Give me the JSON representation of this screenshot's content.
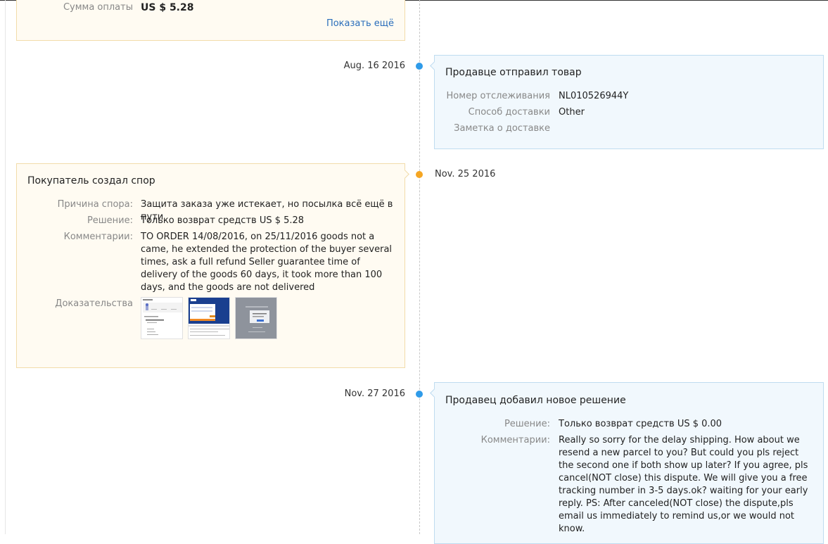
{
  "order_card": {
    "amount_label": "Сумма оплаты",
    "amount_value": "US $ 5.28",
    "show_more": "Показать ещё"
  },
  "events": [
    {
      "date": "Aug. 16 2016",
      "title": "Продавце отправил товар",
      "tracking_label": "Номер отслеживания",
      "tracking_value": "NL010526944Y",
      "method_label": "Способ доставки",
      "method_value": "Other",
      "note_label": "Заметка о доставке"
    },
    {
      "date": "Nov. 25 2016",
      "title": "Покупатель создал спор",
      "reason_label": "Причина спора:",
      "reason_value": "Защита заказа уже истекает, но посылка всё ещё в пути",
      "solution_label": "Решение:",
      "solution_value": "Только возврат средств US $ 5.28",
      "comment_label": "Комментарии:",
      "comment_value": "TO ORDER 14/08/2016, on 25/11/2016 goods not a came, he extended the protection of the buyer several times, ask a full refund Seller guarantee time of delivery of the goods 60 days, it took more than 100 days, and the goods are not delivered",
      "evidence_label": "Доказательства"
    },
    {
      "date": "Nov. 27 2016",
      "title": "Продавец добавил новое решение",
      "solution_label": "Решение:",
      "solution_value": "Только возврат средств US $ 0.00",
      "comment_label": "Комментарии:",
      "comment_value": "Really so sorry for the delay shipping. How about we resend a new parcel to you? But could you pls reject the second one if both show up later? If you agree, pls cancel(NOT close) this dispute. We will give you a free tracking number in 3-5 days.ok? waiting for your early reply. PS: After canceled(NOT close) the dispute,pls email us immediately to remind us,or we would not know."
    }
  ],
  "colors": {
    "seller_dot": "#2f9be9",
    "buyer_dot": "#f5a623",
    "link": "#2a6ebb"
  }
}
